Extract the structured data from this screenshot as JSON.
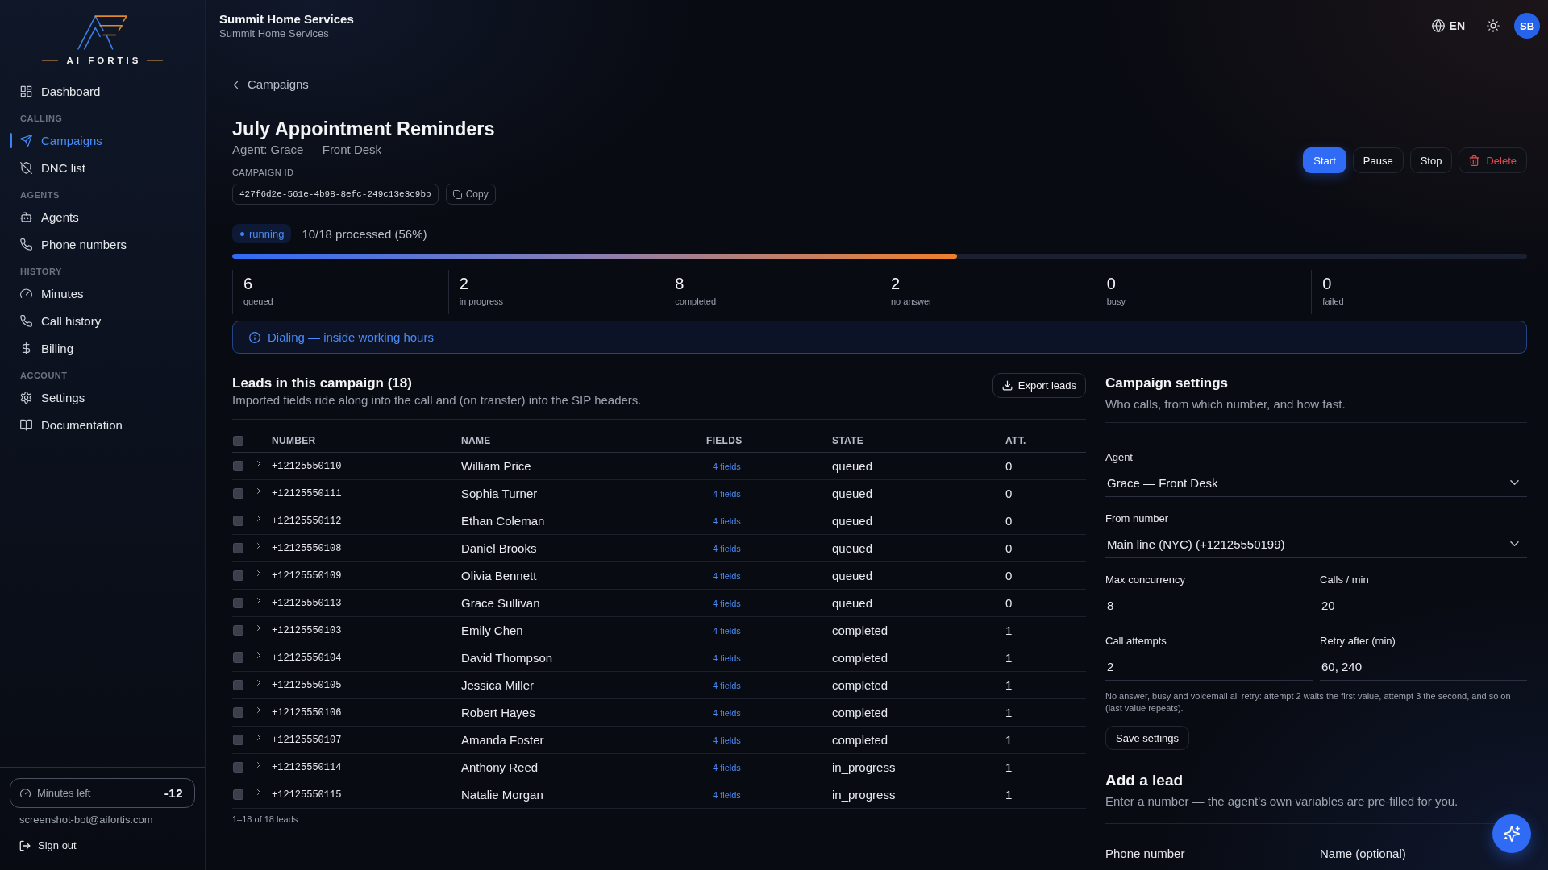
{
  "sidebar": {
    "logo_text": "AI FORTIS",
    "groups": [
      {
        "items": [
          {
            "label": "Dashboard",
            "selected": false
          }
        ]
      },
      {
        "heading": "CALLING",
        "items": [
          {
            "label": "Campaigns",
            "selected": true
          },
          {
            "label": "DNC list",
            "selected": false
          }
        ]
      },
      {
        "heading": "AGENTS",
        "items": [
          {
            "label": "Agents",
            "selected": false
          },
          {
            "label": "Phone numbers",
            "selected": false
          }
        ]
      },
      {
        "heading": "HISTORY",
        "items": [
          {
            "label": "Minutes",
            "selected": false
          },
          {
            "label": "Call history",
            "selected": false
          },
          {
            "label": "Billing",
            "selected": false
          }
        ]
      },
      {
        "heading": "ACCOUNT",
        "items": [
          {
            "label": "Settings",
            "selected": false
          },
          {
            "label": "Documentation",
            "selected": false
          }
        ]
      }
    ],
    "minutes": {
      "label": "Minutes left",
      "value": "-12"
    },
    "email": "screenshot-bot@aifortis.com",
    "sign_out": "Sign out"
  },
  "header": {
    "org_name": "Summit Home Services",
    "org_subtitle": "Summit Home Services",
    "language": "EN",
    "avatar_initials": "SB"
  },
  "campaign": {
    "back_link": "Campaigns",
    "title": "July Appointment Reminders",
    "agent_line": "Agent: Grace — Front Desk",
    "id_label": "CAMPAIGN ID",
    "id": "427f6d2e-561e-4b98-8efc-249c13e3c9bb",
    "copy_button": "Copy",
    "actions": [
      {
        "label": "Start",
        "kind": "primary"
      },
      {
        "label": "Pause",
        "kind": "secondary"
      },
      {
        "label": "Stop",
        "kind": "secondary"
      },
      {
        "label": "Delete",
        "kind": "danger"
      }
    ],
    "status": "running",
    "progress_text": "10/18 processed (56%)",
    "progress": {
      "level": 0.56
    }
  },
  "stats": [
    {
      "value": "6",
      "label": "queued"
    },
    {
      "value": "2",
      "label": "in progress"
    },
    {
      "value": "8",
      "label": "completed"
    },
    {
      "value": "2",
      "label": "no answer"
    },
    {
      "value": "0",
      "label": "busy"
    },
    {
      "value": "0",
      "label": "failed"
    }
  ],
  "banner": {
    "text": "Dialing — inside working hours"
  },
  "leads": {
    "title": "Leads in this campaign (18)",
    "subtitle": "Imported fields ride along into the call and (on transfer) into the SIP headers.",
    "export_button": "Export leads",
    "select_all": {
      "checked": false
    },
    "columns": [
      "NUMBER",
      "NAME",
      "FIELDS",
      "STATE",
      "ATT."
    ],
    "rows": [
      {
        "checked": false,
        "expanded": false,
        "number": "+12125550110",
        "name": "William Price",
        "fields": "4 fields",
        "state": "queued",
        "attempts": "0"
      },
      {
        "checked": false,
        "expanded": false,
        "number": "+12125550111",
        "name": "Sophia Turner",
        "fields": "4 fields",
        "state": "queued",
        "attempts": "0"
      },
      {
        "checked": false,
        "expanded": false,
        "number": "+12125550112",
        "name": "Ethan Coleman",
        "fields": "4 fields",
        "state": "queued",
        "attempts": "0"
      },
      {
        "checked": false,
        "expanded": false,
        "number": "+12125550108",
        "name": "Daniel Brooks",
        "fields": "4 fields",
        "state": "queued",
        "attempts": "0"
      },
      {
        "checked": false,
        "expanded": false,
        "number": "+12125550109",
        "name": "Olivia Bennett",
        "fields": "4 fields",
        "state": "queued",
        "attempts": "0"
      },
      {
        "checked": false,
        "expanded": false,
        "number": "+12125550113",
        "name": "Grace Sullivan",
        "fields": "4 fields",
        "state": "queued",
        "attempts": "0"
      },
      {
        "checked": false,
        "expanded": false,
        "number": "+12125550103",
        "name": "Emily Chen",
        "fields": "4 fields",
        "state": "completed",
        "attempts": "1"
      },
      {
        "checked": false,
        "expanded": false,
        "number": "+12125550104",
        "name": "David Thompson",
        "fields": "4 fields",
        "state": "completed",
        "attempts": "1"
      },
      {
        "checked": false,
        "expanded": false,
        "number": "+12125550105",
        "name": "Jessica Miller",
        "fields": "4 fields",
        "state": "completed",
        "attempts": "1"
      },
      {
        "checked": false,
        "expanded": false,
        "number": "+12125550106",
        "name": "Robert Hayes",
        "fields": "4 fields",
        "state": "completed",
        "attempts": "1"
      },
      {
        "checked": false,
        "expanded": false,
        "number": "+12125550107",
        "name": "Amanda Foster",
        "fields": "4 fields",
        "state": "completed",
        "attempts": "1"
      },
      {
        "checked": false,
        "expanded": false,
        "number": "+12125550114",
        "name": "Anthony Reed",
        "fields": "4 fields",
        "state": "in_progress",
        "attempts": "1"
      },
      {
        "checked": false,
        "expanded": false,
        "number": "+12125550115",
        "name": "Natalie Morgan",
        "fields": "4 fields",
        "state": "in_progress",
        "attempts": "1"
      }
    ],
    "footer": "1–18 of 18 leads"
  },
  "settings": {
    "title": "Campaign settings",
    "subtitle": "Who calls, from which number, and how fast.",
    "fields": [
      {
        "kind": "select",
        "label": "Agent",
        "value": "Grace — Front Desk"
      },
      {
        "kind": "select",
        "label": "From number",
        "value": "Main line (NYC) (+12125550199)"
      },
      {
        "kind": "input",
        "label": "Max concurrency",
        "value": "8"
      },
      {
        "kind": "input",
        "label": "Calls / min",
        "value": "20"
      },
      {
        "kind": "input",
        "label": "Call attempts",
        "value": "2"
      },
      {
        "kind": "input",
        "label": "Retry after (min)",
        "value": "60, 240"
      }
    ],
    "note": "No answer, busy and voicemail all retry: attempt 2 waits the first value, attempt 3 the second, and so on (last value repeats).",
    "save_button": "Save settings"
  },
  "add_lead": {
    "title": "Add a lead",
    "subtitle": "Enter a number — the agent's own variables are pre-filled for you.",
    "fields": [
      {
        "label": "Phone number"
      },
      {
        "label": "Name (optional)"
      }
    ]
  }
}
